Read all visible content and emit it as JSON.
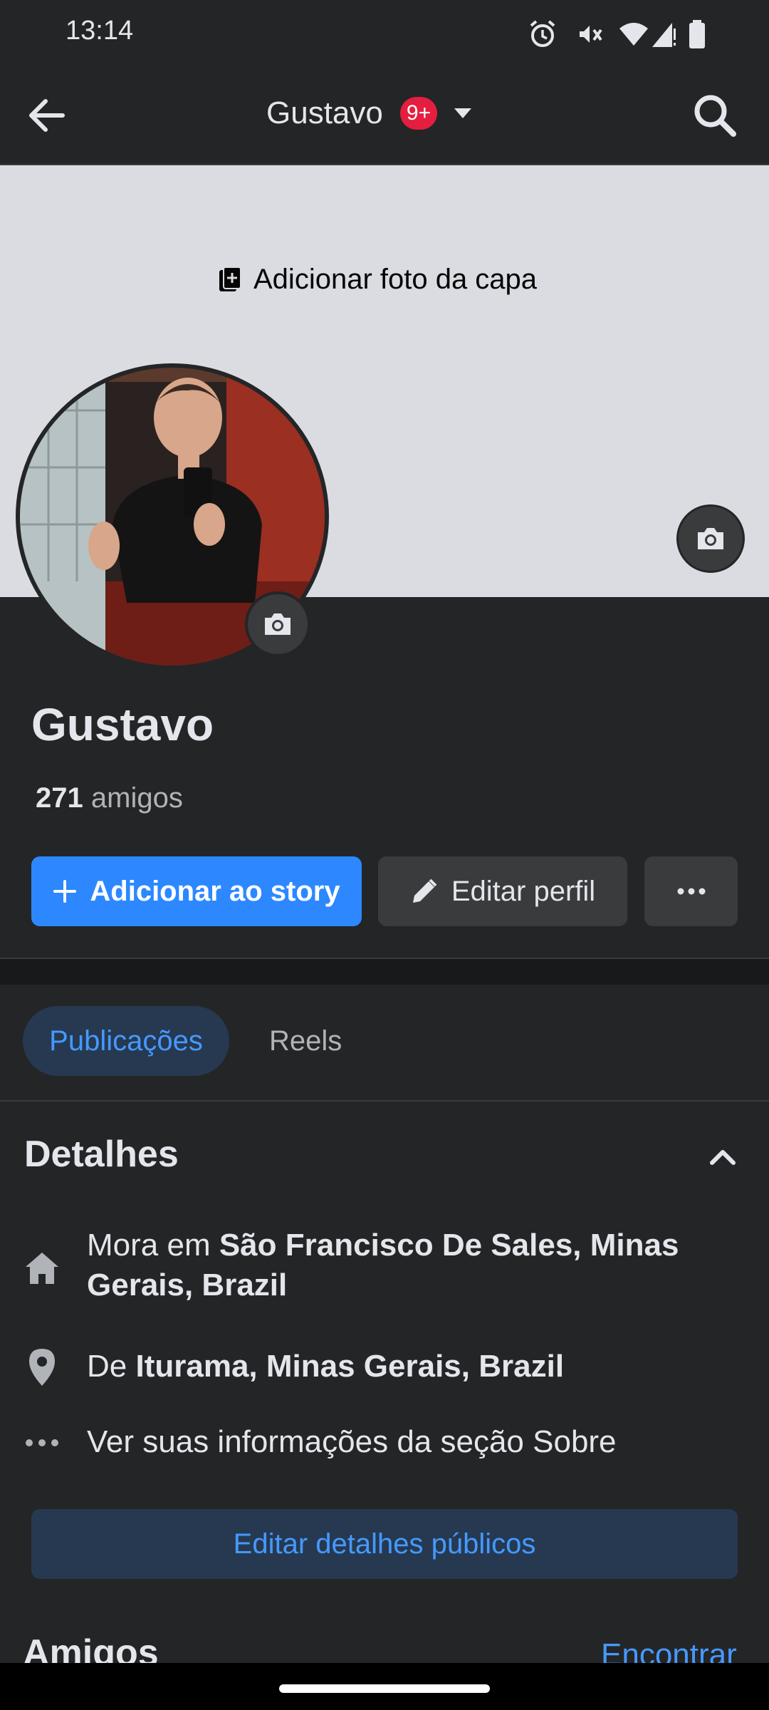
{
  "status_bar": {
    "time": "13:14",
    "icons": [
      "alarm-icon",
      "vibrate-off-icon",
      "wifi-icon",
      "signal-icon",
      "battery-icon"
    ]
  },
  "header": {
    "title": "Gustavo",
    "badge": "9+",
    "icons": [
      "back-arrow-icon",
      "chevron-down-icon",
      "search-icon"
    ]
  },
  "cover": {
    "add_label": "Adicionar foto da capa"
  },
  "profile": {
    "name": "Gustavo",
    "friend_count": "271",
    "friends_label": "amigos"
  },
  "actions": {
    "story_label": "Adicionar ao story",
    "edit_label": "Editar perfil",
    "more_icon": "more-icon"
  },
  "tabs": [
    {
      "label": "Publicações",
      "selected": true
    },
    {
      "label": "Reels",
      "selected": false
    }
  ],
  "details": {
    "title": "Detalhes",
    "lives_prefix": "Mora em",
    "lives_place": "São Francisco De Sales, Minas Gerais, Brazil",
    "from_prefix": "De",
    "from_place": "Iturama, Minas Gerais, Brazil",
    "about_link": "Ver suas informações da seção Sobre",
    "edit_public_label": "Editar detalhes públicos"
  },
  "friends_section": {
    "title": "Amigos",
    "find_label": "Encontrar"
  },
  "colors": {
    "background": "#242527",
    "accent": "#2d88ff",
    "badge": "#e41e3f",
    "cover": "#dadce1"
  }
}
